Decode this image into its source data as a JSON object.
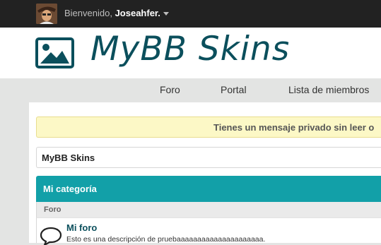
{
  "topbar": {
    "welcome_prefix": "Bienvenido, ",
    "username": "Joseahfer."
  },
  "header": {
    "logo_icon": "image-icon",
    "logo_text": "MyBB Skins"
  },
  "nav": {
    "items": [
      {
        "label": "Foro"
      },
      {
        "label": "Portal"
      },
      {
        "label": "Lista de miembros"
      }
    ]
  },
  "notice": {
    "text": "Tienes un mensaje privado sin leer o"
  },
  "breadcrumb": {
    "label": "MyBB Skins"
  },
  "category": {
    "title": "Mi categoría",
    "column_header": "Foro",
    "forums": [
      {
        "name": "Mi foro",
        "description": "Esto es una descripción de pruebaaaaaaaaaaaaaaaaaaaaa.",
        "icon": "speech-bubble-icon"
      }
    ]
  },
  "colors": {
    "topbar": "#222222",
    "brand": "#0b4f5c",
    "category_header": "#12a0a8",
    "notice_bg": "#fcf8c6"
  }
}
